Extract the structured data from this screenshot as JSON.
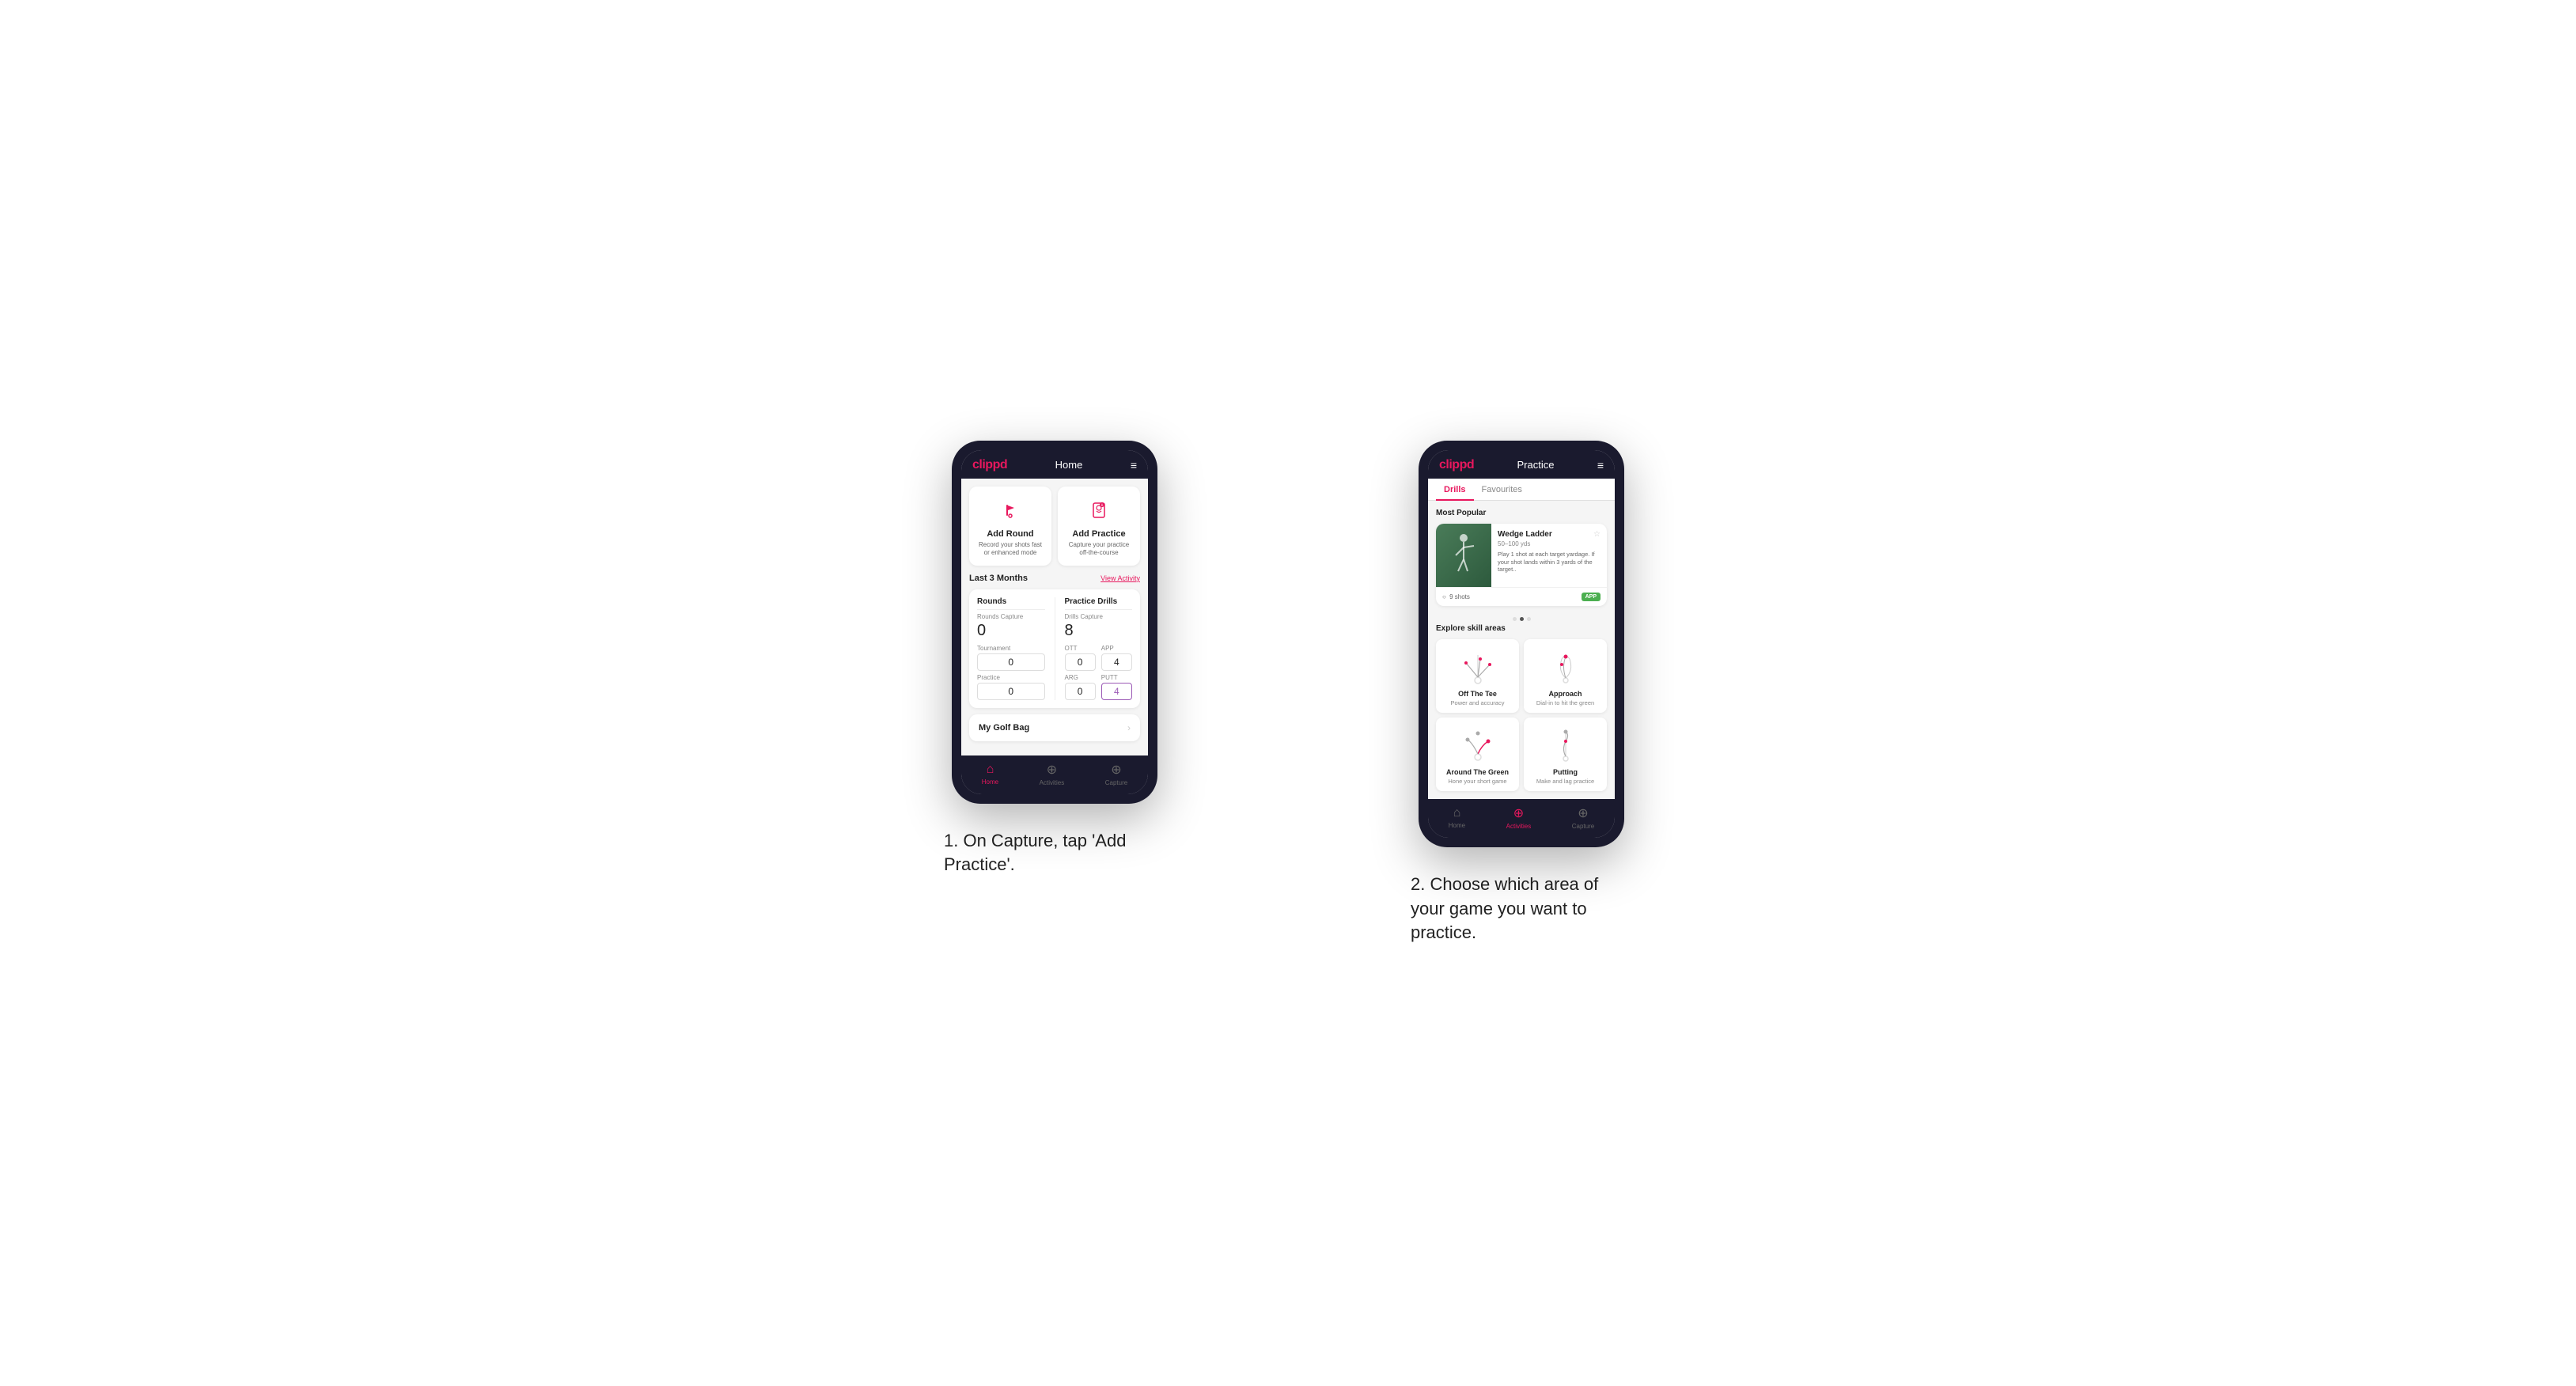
{
  "phone1": {
    "header": {
      "logo": "clippd",
      "title": "Home",
      "menu_icon": "≡"
    },
    "action_cards": [
      {
        "id": "add-round",
        "title": "Add Round",
        "description": "Record your shots fast or enhanced mode"
      },
      {
        "id": "add-practice",
        "title": "Add Practice",
        "description": "Capture your practice off-the-course"
      }
    ],
    "stats_section": {
      "heading": "Last 3 Months",
      "view_link": "View Activity",
      "rounds": {
        "title": "Rounds",
        "capture_label": "Rounds Capture",
        "capture_value": "0",
        "tournament_label": "Tournament",
        "tournament_value": "0",
        "practice_label": "Practice",
        "practice_value": "0"
      },
      "practice_drills": {
        "title": "Practice Drills",
        "capture_label": "Drills Capture",
        "capture_value": "8",
        "ott_label": "OTT",
        "ott_value": "0",
        "app_label": "APP",
        "app_value": "4",
        "arg_label": "ARG",
        "arg_value": "0",
        "putt_label": "PUTT",
        "putt_value": "4"
      }
    },
    "golf_bag": {
      "label": "My Golf Bag"
    },
    "nav": {
      "items": [
        {
          "icon": "home",
          "label": "Home",
          "active": true
        },
        {
          "icon": "activities",
          "label": "Activities",
          "active": false
        },
        {
          "icon": "capture",
          "label": "Capture",
          "active": false
        }
      ]
    }
  },
  "phone2": {
    "header": {
      "logo": "clippd",
      "title": "Practice",
      "menu_icon": "≡"
    },
    "tabs": [
      {
        "label": "Drills",
        "active": true
      },
      {
        "label": "Favourites",
        "active": false
      }
    ],
    "most_popular": {
      "heading": "Most Popular",
      "card": {
        "title": "Wedge Ladder",
        "subtitle": "50–100 yds",
        "description": "Play 1 shot at each target yardage. If your shot lands within 3 yards of the target..",
        "shots": "9 shots",
        "badge": "APP"
      },
      "dots": [
        false,
        true,
        false
      ]
    },
    "skill_areas": {
      "heading": "Explore skill areas",
      "items": [
        {
          "name": "Off The Tee",
          "desc": "Power and accuracy",
          "type": "ott"
        },
        {
          "name": "Approach",
          "desc": "Dial-in to hit the green",
          "type": "approach"
        },
        {
          "name": "Around The Green",
          "desc": "Hone your short game",
          "type": "atg"
        },
        {
          "name": "Putting",
          "desc": "Make and lag practice",
          "type": "putt"
        }
      ]
    },
    "nav": {
      "items": [
        {
          "icon": "home",
          "label": "Home",
          "active": false
        },
        {
          "icon": "activities",
          "label": "Activities",
          "active": true
        },
        {
          "icon": "capture",
          "label": "Capture",
          "active": false
        }
      ]
    }
  },
  "captions": {
    "caption1": "1. On Capture, tap\n'Add Practice'.",
    "caption2": "2. Choose which\narea of your game\nyou want to practice."
  }
}
